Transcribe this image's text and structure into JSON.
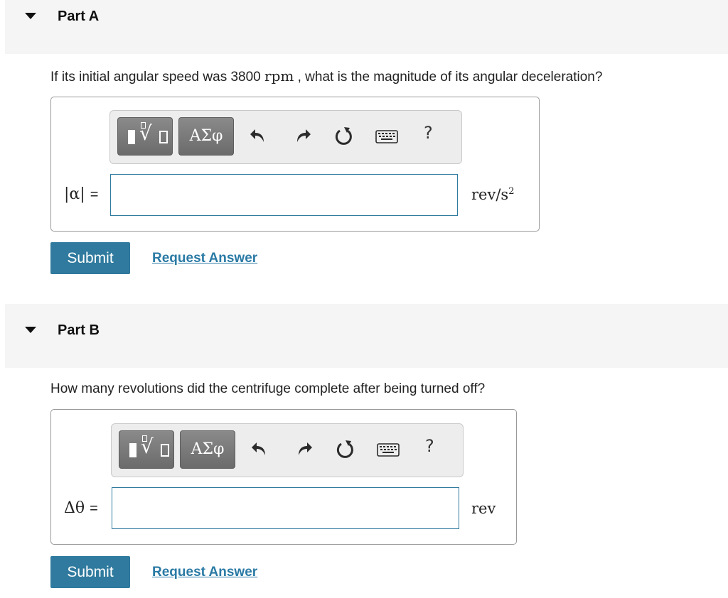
{
  "parts": [
    {
      "title": "Part A",
      "question_before": "If its initial angular speed was 3800 ",
      "question_math": "rpm",
      "question_after": " , what is the magnitude of its angular deceleration?",
      "toolbar": {
        "templates_icon": "templates-sqrt-icon",
        "greek_label": "ΑΣφ",
        "undo_icon": "undo-icon",
        "redo_icon": "redo-icon",
        "reset_icon": "reset-icon",
        "keyboard_icon": "keyboard-icon",
        "help_label": "?"
      },
      "variable_label": "|α|",
      "equals": "=",
      "input_value": "",
      "unit_base": "rev/s",
      "unit_sup": "2",
      "submit_label": "Submit",
      "request_label": "Request Answer"
    },
    {
      "title": "Part B",
      "question_before": "How many revolutions did the centrifuge complete after being turned off?",
      "question_math": "",
      "question_after": "",
      "toolbar": {
        "templates_icon": "templates-sqrt-icon",
        "greek_label": "ΑΣφ",
        "undo_icon": "undo-icon",
        "redo_icon": "redo-icon",
        "reset_icon": "reset-icon",
        "keyboard_icon": "keyboard-icon",
        "help_label": "?"
      },
      "variable_label": "Δθ",
      "equals": "=",
      "input_value": "",
      "unit_base": "rev",
      "unit_sup": "",
      "submit_label": "Submit",
      "request_label": "Request Answer"
    }
  ],
  "colors": {
    "accent": "#2f7a9e",
    "link": "#2a7aa5",
    "header_bg": "#f5f5f5"
  }
}
